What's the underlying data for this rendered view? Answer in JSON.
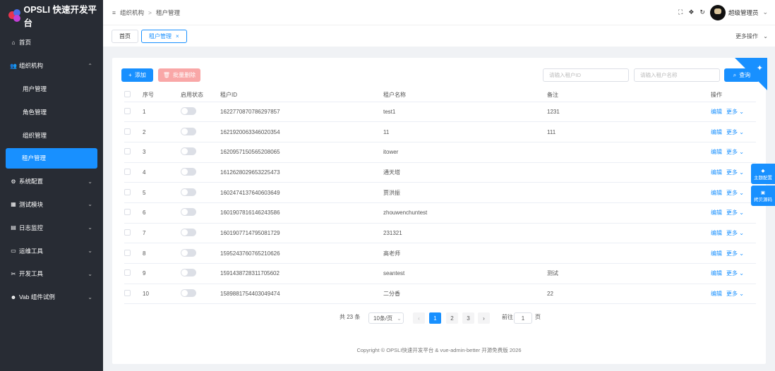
{
  "app": {
    "title": "OPSLI 快速开发平台"
  },
  "sidebar": {
    "items": [
      {
        "label": "首页",
        "icon": "home-icon",
        "glyph": "⌂",
        "arrow": ""
      },
      {
        "label": "组织机构",
        "icon": "users-icon",
        "glyph": "👥",
        "arrow": "⌃"
      },
      {
        "label": "用户管理",
        "sub": true
      },
      {
        "label": "角色管理",
        "sub": true
      },
      {
        "label": "组织管理",
        "sub": true
      },
      {
        "label": "租户管理",
        "sub": true,
        "active": true
      },
      {
        "label": "系统配置",
        "icon": "gear-icon",
        "glyph": "⚙",
        "arrow": "⌄"
      },
      {
        "label": "测试模块",
        "icon": "cube-icon",
        "glyph": "▦",
        "arrow": "⌄"
      },
      {
        "label": "日志监控",
        "icon": "doc-icon",
        "glyph": "▤",
        "arrow": "⌄"
      },
      {
        "label": "运维工具",
        "icon": "monitor-icon",
        "glyph": "▭",
        "arrow": "⌄"
      },
      {
        "label": "开发工具",
        "icon": "tools-icon",
        "glyph": "✂",
        "arrow": "⌄"
      },
      {
        "label": "Vab 组件试例",
        "icon": "group-icon",
        "glyph": "☻",
        "arrow": "⌄"
      }
    ]
  },
  "header": {
    "breadcrumb": [
      "组织机构",
      "租户管理"
    ],
    "breadcrumb_icon": "≡",
    "user_name": "超级管理员"
  },
  "tabs": {
    "items": [
      "首页",
      "租户管理"
    ],
    "close": "×",
    "more": "更多操作"
  },
  "toolbar": {
    "add": "添加",
    "batch_delete": "批量删除",
    "search_id_placeholder": "请输入租户ID",
    "search_name_placeholder": "请输入租户名称",
    "search": "查询"
  },
  "table": {
    "headers": [
      "序号",
      "启用状态",
      "租户ID",
      "租户名称",
      "备注",
      "操作"
    ],
    "edit": "编辑",
    "more": "更多",
    "rows": [
      [
        "1",
        "1622770870786297857",
        "test1",
        "1231"
      ],
      [
        "2",
        "1621920063346020354",
        "11",
        "111"
      ],
      [
        "3",
        "1620957150565208065",
        "itower",
        ""
      ],
      [
        "4",
        "1612628029653225473",
        "通天塔",
        ""
      ],
      [
        "5",
        "1602474137640603649",
        "贾洪振",
        ""
      ],
      [
        "6",
        "1601907816146243586",
        "zhouwenchuntest",
        ""
      ],
      [
        "7",
        "1601907714795081729",
        "231321",
        ""
      ],
      [
        "8",
        "1595243760765210626",
        "高老师",
        ""
      ],
      [
        "9",
        "1591438728311705602",
        "seantest",
        "测试"
      ],
      [
        "10",
        "1589881754403049474",
        "二分香",
        "22"
      ]
    ]
  },
  "pagination": {
    "total": "共 23 条",
    "page_size": "10条/页",
    "pages": [
      "1",
      "2",
      "3"
    ],
    "current": "1",
    "goto_prefix": "前往",
    "goto_value": "1",
    "goto_suffix": "页"
  },
  "footer": {
    "text": "Copyright © OPSLI快速开发平台 & vue-admin-better 开源免费版 2026"
  },
  "float": {
    "theme": "主题配置",
    "copy": "拷贝源码"
  },
  "colors": {
    "primary": "#1890ff",
    "sidebar": "#282c34",
    "danger_light": "#f9a7a7"
  }
}
